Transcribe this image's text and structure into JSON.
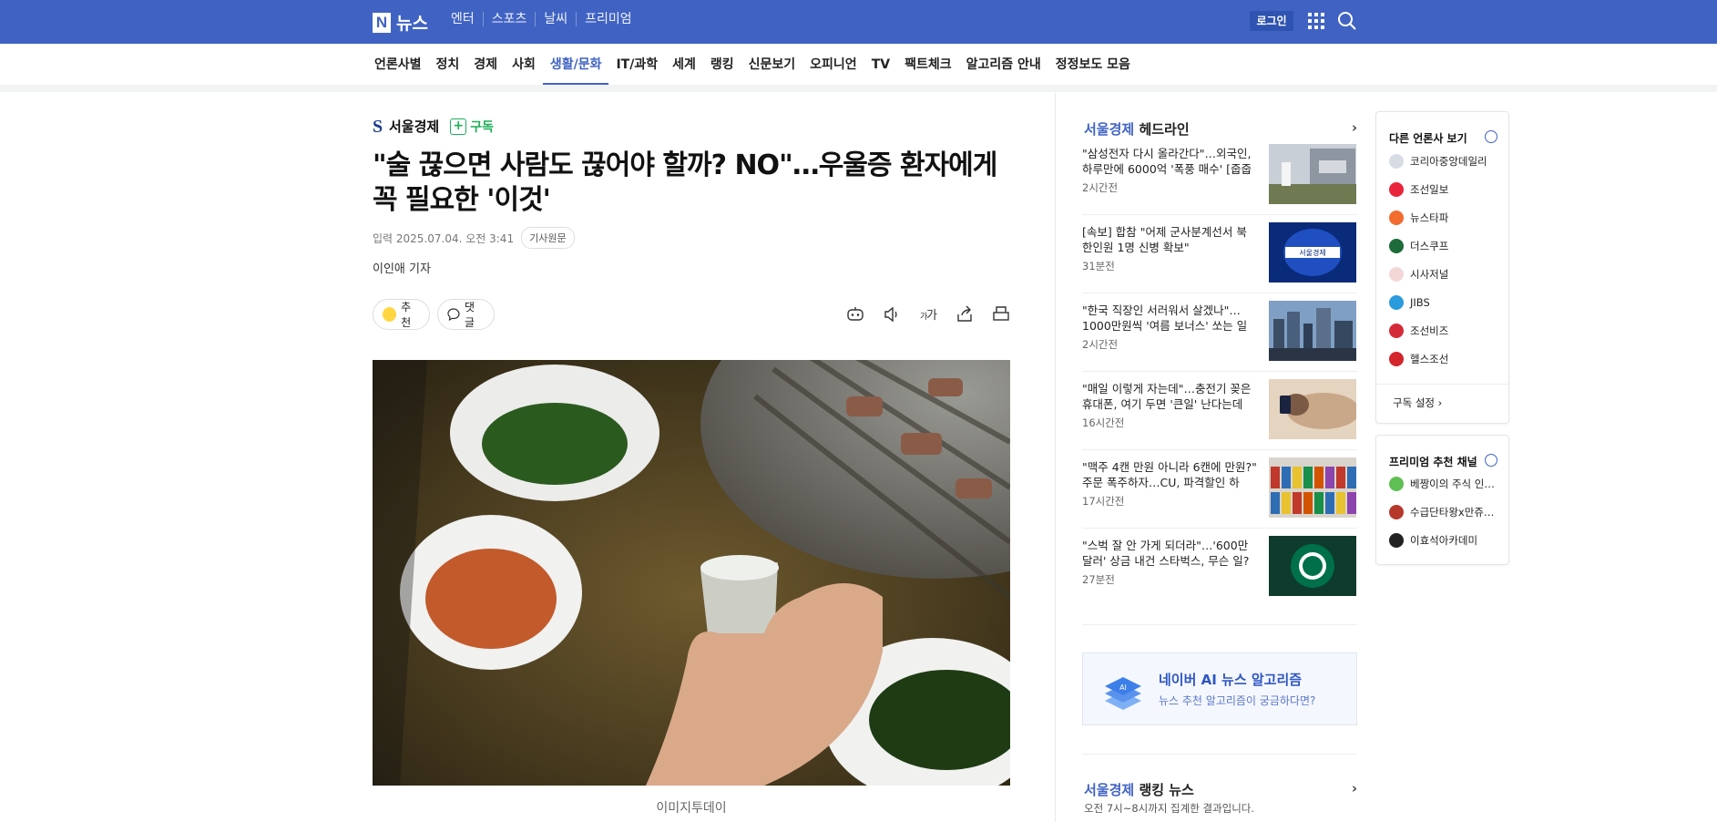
{
  "topbar": {
    "logo_text": "뉴스",
    "nav": [
      "엔터",
      "스포츠",
      "날씨",
      "프리미엄"
    ],
    "login": "로그인"
  },
  "categories": [
    "언론사별",
    "정치",
    "경제",
    "사회",
    "생활/문화",
    "IT/과학",
    "세계",
    "랭킹",
    "신문보기",
    "오피니언",
    "TV",
    "팩트체크",
    "알고리즘 안내",
    "정정보도 모음"
  ],
  "active_category": "생활/문화",
  "article": {
    "press": "서울경제",
    "subscribe": "구독",
    "title": "\"술 끊으면 사람도 끊어야 할까? NO\"…우울증 환자에게 꼭 필요한 '이것'",
    "date": "입력 2025.07.04. 오전 3:41",
    "original": "기사원문",
    "reporter": "이인애 기자",
    "like": "추천",
    "comment": "댓글",
    "caption": "이미지투데이"
  },
  "right": {
    "headline_press": "서울경제",
    "headline_label": "헤드라인",
    "headlines": [
      {
        "title": "\"삼성전자 다시 올라간다\"…외국인, 하루만에 6000억 '폭풍 매수' [줍줍 리…",
        "time": "2시간전"
      },
      {
        "title": "[속보] 합참 \"어제 군사분계선서 북한인원 1명 신병 확보\"",
        "time": "31분전"
      },
      {
        "title": "\"한국 직장인 서러워서 살겠나\"…1000만원씩 '여름 보너스' 쏘는 일본 기업들",
        "time": "2시간전"
      },
      {
        "title": "\"매일 이렇게 자는데\"…충전기 꽂은 휴대폰, 여기 두면 '큰일' 난다는데",
        "time": "16시간전"
      },
      {
        "title": "\"맥주 4캔 만원 아니라 6캔에 만원?\" 주문 폭주하자…CU, 파격할인 하루…",
        "time": "17시간전"
      },
      {
        "title": "\"스벅 잘 안 가게 되더라\"…'600만달러' 상금 내건 스타벅스, 무슨 일?",
        "time": "27분전"
      }
    ],
    "ai_title": "네이버 AI 뉴스 알고리즘",
    "ai_sub": "뉴스 추천 알고리즘이 궁금하다면?",
    "ranking_press": "서울경제",
    "ranking_label": "랭킹 뉴스",
    "ranking_sub": "오전 7시~8시까지 집계한 결과입니다."
  },
  "far_right": {
    "other_press_title": "다른 언론사 보기",
    "presses": [
      {
        "name": "코리아중앙데일리",
        "color": "#d6dbe4"
      },
      {
        "name": "조선일보",
        "color": "#e8253a"
      },
      {
        "name": "뉴스타파",
        "color": "#f26b2f"
      },
      {
        "name": "더스쿠프",
        "color": "#1e6b3a"
      },
      {
        "name": "시사저널",
        "color": "#f3d7d7"
      },
      {
        "name": "JIBS",
        "color": "#2a9bdc"
      },
      {
        "name": "조선비즈",
        "color": "#d42a3a"
      },
      {
        "name": "헬스조선",
        "color": "#d4242c"
      }
    ],
    "settings": "구독 설정",
    "premium_title": "프리미엄 추천 채널",
    "premium": [
      {
        "name": "베짱이의 주식 인…",
        "color": "#5fbf54"
      },
      {
        "name": "수급단타왕x만쥬…",
        "color": "#b5382b"
      },
      {
        "name": "이효석아카데미",
        "color": "#222222"
      }
    ]
  }
}
